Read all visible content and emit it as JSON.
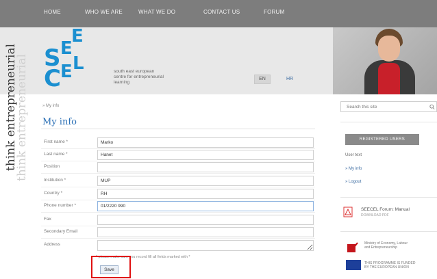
{
  "nav": {
    "items": [
      "HOME",
      "WHO WE ARE",
      "WHAT WE DO",
      "CONTACT US",
      "FORUM"
    ]
  },
  "header": {
    "logo_letters": [
      "S",
      "E",
      "E",
      "C",
      "E",
      "L"
    ],
    "tagline": [
      "south east european",
      "centre for entrepreneurial",
      "learning"
    ],
    "lang_active": "EN",
    "lang_other": "HR"
  },
  "left_banner": {
    "primary": "think entrepreneurial",
    "secondary": "think entrepreneurial"
  },
  "main": {
    "breadcrumb": "» My info",
    "title": "My info",
    "form": {
      "fields": [
        {
          "label": "First name *",
          "value": "Marko"
        },
        {
          "label": "Last name *",
          "value": "Hanet"
        },
        {
          "label": "Position",
          "value": ""
        },
        {
          "label": "Institution *",
          "value": "MUP"
        },
        {
          "label": "Country *",
          "value": "RH"
        },
        {
          "label": "Phone number *",
          "value": "01/2220 990"
        },
        {
          "label": "Fax",
          "value": ""
        },
        {
          "label": "Secondary Email",
          "value": ""
        },
        {
          "label": "Address",
          "value": ""
        }
      ],
      "required_note": "* please make sure you record fill all fields marked with *",
      "save_label": "Save"
    }
  },
  "sidebar": {
    "search_placeholder": "Search this site",
    "registered_users": "REGISTERED USERS",
    "user_text": "User text",
    "links": [
      "» My info",
      "» Logout"
    ],
    "pdf": {
      "title": "SEECEL Forum: Manual",
      "sub": "DOWNLOAD PDF"
    },
    "ministry": [
      "Ministry of Economy, Labour",
      "and Entrepreneurship"
    ],
    "eu": [
      "THIS PROGRAMME IS FUNDED",
      "BY THE EUROPEAN UNION"
    ]
  },
  "colors": {
    "nav_bg": "#7d7d7d",
    "brand_blue": "#1b8fd0",
    "title_blue": "#2a6fb5",
    "highlight_red": "#e01010"
  }
}
